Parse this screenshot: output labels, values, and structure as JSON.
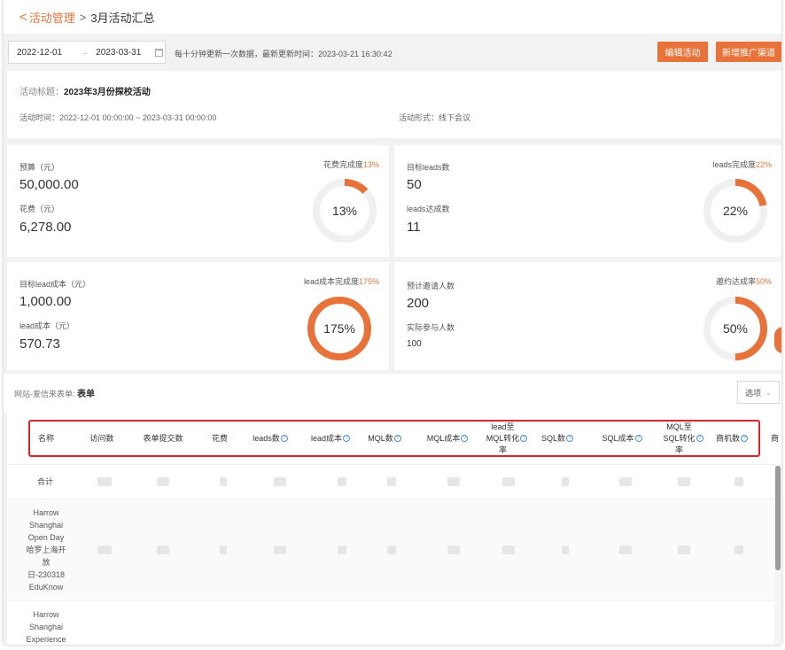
{
  "breadcrumb": {
    "back_icon": "chevron-left-icon",
    "parent": "活动管理",
    "separator": ">",
    "current": "3月活动汇总"
  },
  "toolbar": {
    "date_start": "2022-12-01",
    "date_end": "2023-03-31",
    "date_arrow": "→",
    "update_note": "每十分钟更新一次数据，最新更新时间：2023-03-21 16:30:42",
    "edit_button": "编辑活动",
    "channel_button": "新增推广渠道"
  },
  "info": {
    "title_label": "活动标题：",
    "title_value": "2023年3月份探校活动",
    "time_label": "活动时间：",
    "time_value": "2022-12-01 00:00:00 ~ 2023-03-31 00:00:00",
    "form_label": "活动形式：",
    "form_value": "线下会议"
  },
  "cards": {
    "budget": {
      "label1": "预算（元）",
      "value1": "50,000.00",
      "label2": "花费（元）",
      "value2": "6,278.00",
      "ring_label": "花费完成度",
      "ring_pct": "13%",
      "progress": 0.13
    },
    "leads": {
      "label1": "目标leads数",
      "value1": "50",
      "label2": "leads达成数",
      "value2": "11",
      "ring_label": "leads完成度",
      "ring_pct": "22%",
      "progress": 0.22
    },
    "lead_cost": {
      "label1": "目标lead成本（元）",
      "value1": "1,000.00",
      "label2": "lead成本（元）",
      "value2": "570.73",
      "ring_label": "lead成本完成度",
      "ring_pct": "175%",
      "progress": 1.0
    },
    "invite": {
      "label1": "预计邀请人数",
      "value1": "200",
      "label2": "实际参与人数",
      "value2": "100",
      "ring_label": "邀约达成率",
      "ring_pct": "50%",
      "progress": 0.5
    }
  },
  "source": {
    "prefix": "网站-爱信来表单: ",
    "name": "表单",
    "options_label": "选项",
    "options_icon": "chevron-down-icon"
  },
  "table": {
    "columns": [
      "名称",
      "访问数",
      "表单提交数",
      "花费",
      "leads数",
      "lead成本",
      "MQL数",
      "MQL成本",
      "lead至\nMQL转化\n率",
      "SQL数",
      "SQL成本",
      "MQL至\nSQL转化\n率",
      "商机数",
      "商"
    ],
    "help_icon": "question-circle-icon",
    "total_label": "合计",
    "rows": [
      {
        "name": "Harrow\nShanghai\nOpen Day\n哈罗上海开\n放\n日-230318\nEduKnow"
      },
      {
        "name": "Harrow\nShanghai\nExperience"
      }
    ]
  },
  "colors": {
    "accent": "#e8733a",
    "highlight": "#d9262a",
    "help": "#4a90d9"
  }
}
